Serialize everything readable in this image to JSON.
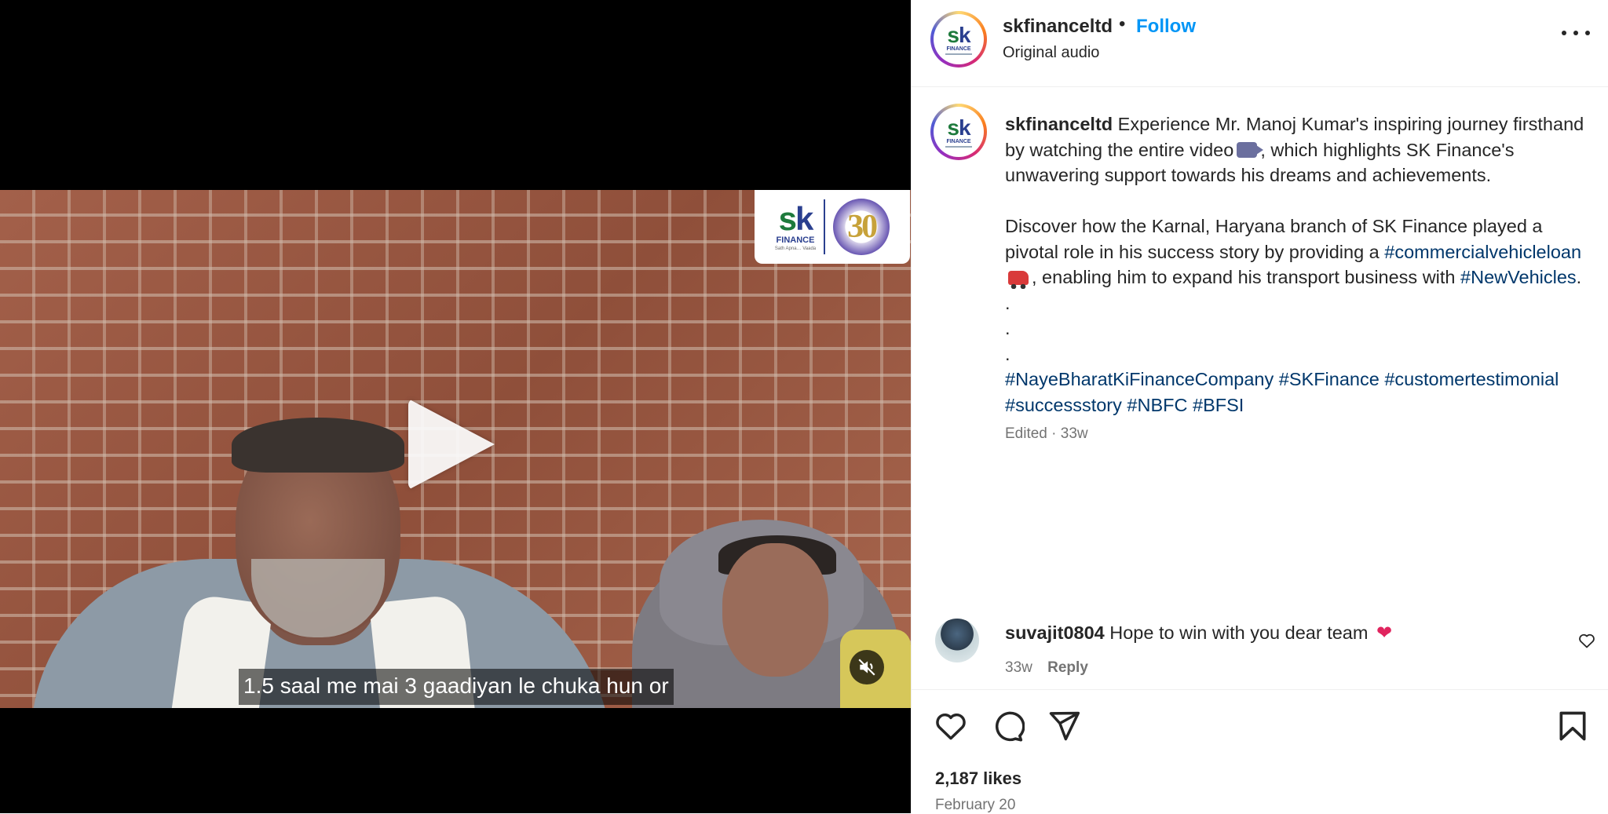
{
  "video": {
    "subtitle": "1.5 saal me mai 3 gaadiyan le chuka hun or",
    "logo_text": "sk",
    "logo_sub": "FINANCE",
    "logo_tagline": "Sath Apna… Vaada",
    "anniversary": "30",
    "play_icon": "play-icon",
    "mute_icon": "muted-speaker-icon"
  },
  "header": {
    "username": "skfinanceltd",
    "separator": "•",
    "follow_label": "Follow",
    "audio_label": "Original audio",
    "more_icon": "more-options-icon"
  },
  "caption": {
    "username": "skfinanceltd",
    "p1_before": "Experience Mr. Manoj Kumar's inspiring journey firsthand by watching the entire video",
    "p1_after": ", which highlights SK Finance's unwavering support towards his dreams and achievements.",
    "p2_before": "Discover how the Karnal, Haryana branch of SK Finance played a pivotal role in his success story by providing a",
    "tag_cv": "#commercialvehicleloan",
    "p2_mid": ", enabling him to expand his transport business with",
    "tag_nv": "#NewVehicles",
    "p2_end": ".",
    "dots": [
      ".",
      ".",
      "."
    ],
    "tags": [
      "#NayeBharatKiFinanceCompany",
      "#SKFinance",
      "#customertestimonial",
      "#successstory",
      "#NBFC",
      "#BFSI"
    ],
    "meta": "Edited · 33w"
  },
  "comment": {
    "username": "suvajit0804",
    "text": "Hope to win with you dear team",
    "emoji": "❤",
    "time": "33w",
    "reply_label": "Reply"
  },
  "actions": {
    "icons": [
      "heart-icon",
      "comment-icon",
      "share-icon",
      "bookmark-icon"
    ],
    "likes": "2,187 likes",
    "date": "February 20"
  },
  "colors": {
    "follow": "#0095f6",
    "hashtag": "#00376b",
    "muted_text": "#737373",
    "heart": "#e0245e"
  }
}
